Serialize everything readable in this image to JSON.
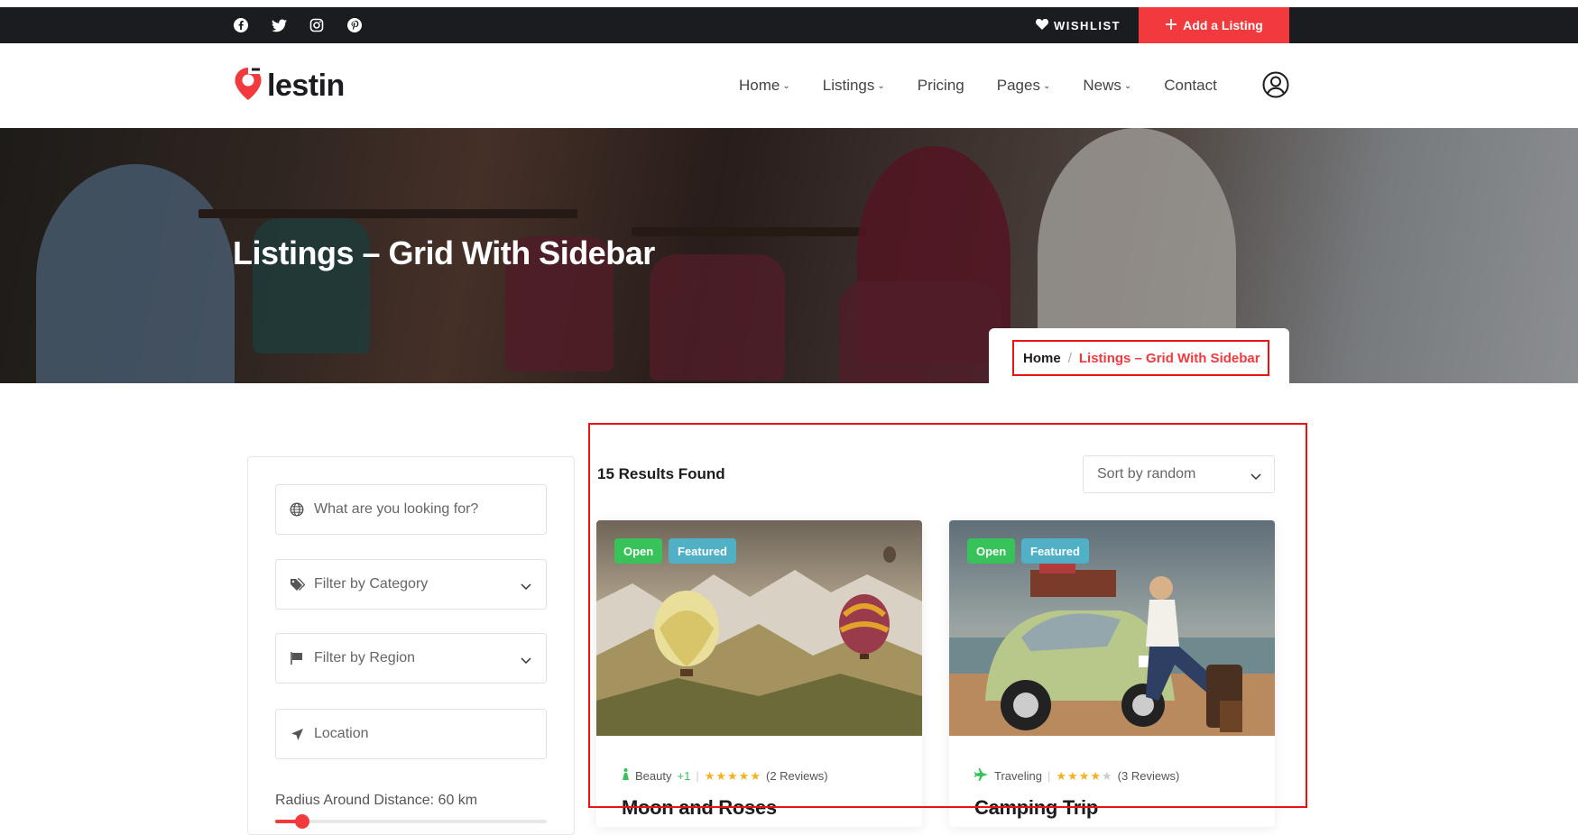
{
  "topbar": {
    "social": [
      "facebook-icon",
      "twitter-icon",
      "instagram-icon",
      "pinterest-icon"
    ],
    "wishlist_label": "WISHLIST",
    "add_listing_label": "Add a Listing"
  },
  "header": {
    "logo_text": "lestin",
    "nav": [
      {
        "label": "Home",
        "has_dropdown": true
      },
      {
        "label": "Listings",
        "has_dropdown": true
      },
      {
        "label": "Pricing",
        "has_dropdown": false
      },
      {
        "label": "Pages",
        "has_dropdown": true
      },
      {
        "label": "News",
        "has_dropdown": true
      },
      {
        "label": "Contact",
        "has_dropdown": false
      }
    ]
  },
  "hero": {
    "title": "Listings – Grid With Sidebar",
    "breadcrumb": {
      "home": "Home",
      "separator": "/",
      "current": "Listings – Grid With Sidebar"
    }
  },
  "sidebar": {
    "search_placeholder": "What are you looking for?",
    "category_placeholder": "Filter by Category",
    "region_placeholder": "Filter by Region",
    "location_placeholder": "Location",
    "radius_label": "Radius Around Distance: 60 km",
    "radius_fraction": 0.1
  },
  "results": {
    "count_label": "15 Results Found",
    "sort_value": "Sort by random"
  },
  "cards": [
    {
      "badges": [
        "Open",
        "Featured"
      ],
      "category": "Beauty",
      "category_extra": "+1",
      "rating": 5,
      "reviews": "(2 Reviews)",
      "title": "Moon and Roses"
    },
    {
      "badges": [
        "Open",
        "Featured"
      ],
      "category": "Traveling",
      "category_extra": "",
      "rating": 4,
      "reviews": "(3 Reviews)",
      "title": "Camping Trip"
    }
  ],
  "colors": {
    "accent": "#f23a3e",
    "dark": "#1b1c20",
    "open_badge": "#37c25a",
    "featured_badge": "#4fb0c6",
    "star": "#f6b11f"
  }
}
